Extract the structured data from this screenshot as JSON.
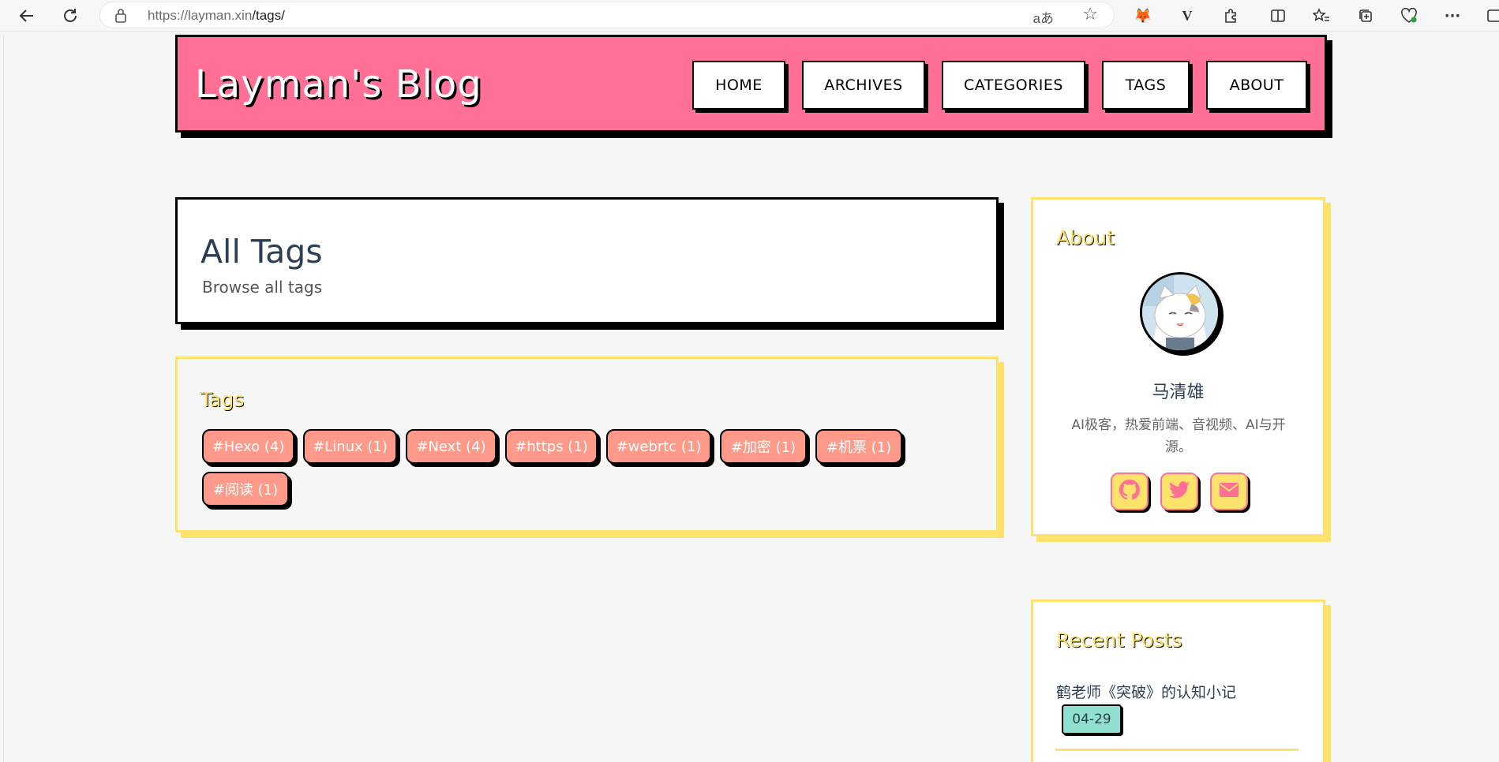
{
  "browser": {
    "url_host": "https://layman.xin",
    "url_path": "/tags/",
    "read_aloud": "aあ"
  },
  "site": {
    "brand": "Layman's Blog",
    "nav": [
      "HOME",
      "ARCHIVES",
      "CATEGORIES",
      "TAGS",
      "ABOUT"
    ]
  },
  "page_header": {
    "title": "All Tags",
    "subtitle": "Browse all tags"
  },
  "tags_card": {
    "title": "Tags",
    "tags": [
      "#Hexo (4)",
      "#Linux (1)",
      "#Next (4)",
      "#https (1)",
      "#webrtc (1)",
      "#加密 (1)",
      "#机票 (1)",
      "#阅读 (1)"
    ]
  },
  "about": {
    "title": "About",
    "author": "马清雄",
    "description": "AI极客，热爱前端、音视频、AI与开源。",
    "social": [
      "github-icon",
      "twitter-icon",
      "envelope-icon"
    ]
  },
  "recent_posts": {
    "title": "Recent Posts",
    "posts": [
      {
        "title": "鹤老师《突破》的认知小记",
        "date": "04-29"
      }
    ]
  },
  "colors": {
    "header_bg": "#ff6f96",
    "accent_yellow": "#fde26c",
    "tag_bg": "#ff9a8a",
    "date_bg": "#8fe0cf"
  }
}
